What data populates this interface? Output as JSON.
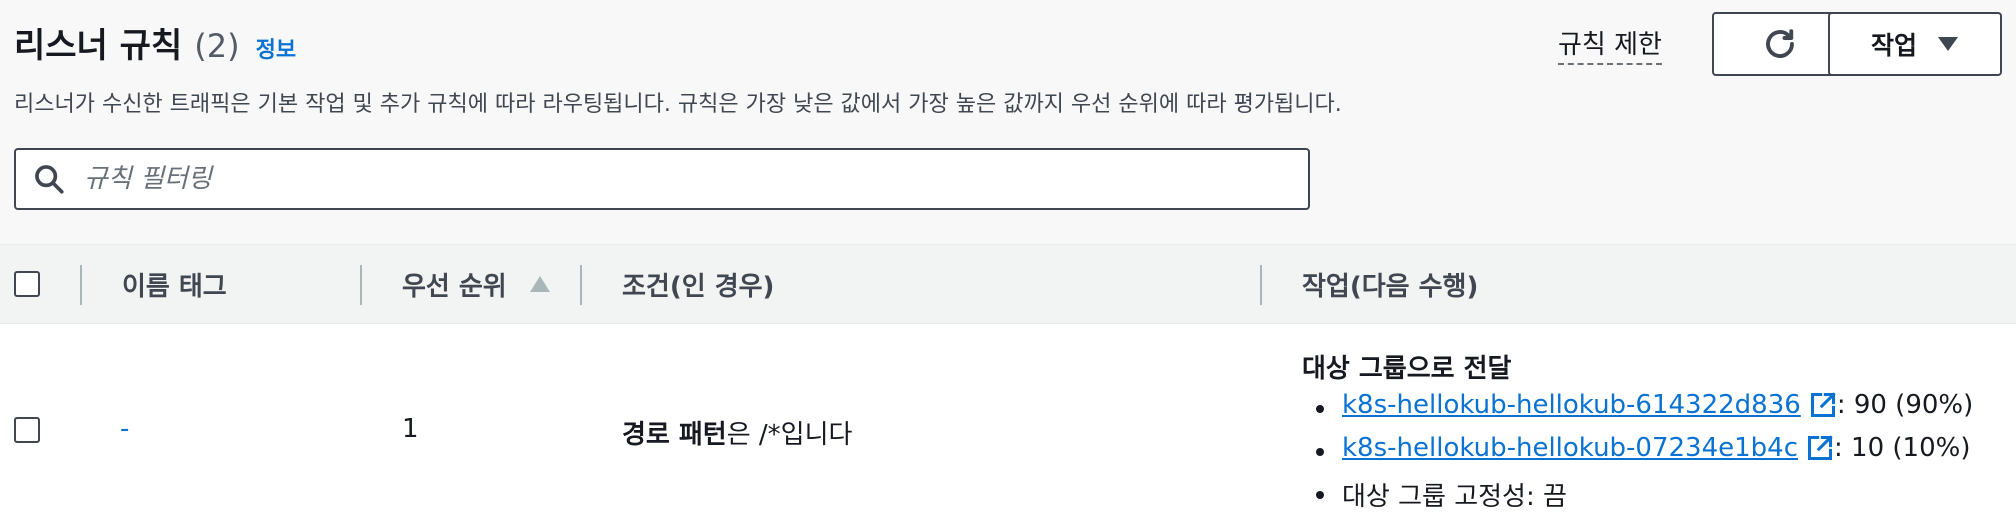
{
  "header": {
    "title": "리스너 규칙",
    "count": "(2)",
    "info_link": "정보",
    "description": "리스너가 수신한 트래픽은 기본 작업 및 추가 규칙에 따라 라우팅됩니다. 규칙은 가장 낮은 값에서 가장 높은 값까지 우선 순위에 따라 평가됩니다.",
    "rule_limit_label": "규칙 제한",
    "actions_button_label": "작업"
  },
  "search": {
    "placeholder": "규칙 필터링",
    "value": ""
  },
  "table": {
    "columns": [
      "이름 태그",
      "우선 순위",
      "조건(인 경우)",
      "작업(다음 수행)"
    ],
    "sort_column": "우선 순위",
    "sort_direction": "ascending",
    "rows": [
      {
        "name_tag": "-",
        "priority": "1",
        "condition_bold": "경로 패턴",
        "condition_rest": "은 /*입니다",
        "action_title": "대상 그룹으로 전달",
        "targets": [
          {
            "name": "k8s-hellokub-hellokub-614322d836",
            "weight": ": 90 (90%)"
          },
          {
            "name": "k8s-hellokub-hellokub-07234e1b4c",
            "weight": ": 10 (10%)"
          }
        ],
        "stickiness": "대상 그룹 고정성: 끔"
      }
    ]
  },
  "colors": {
    "link": "#0972d3",
    "text": "#16191f",
    "header_bg": "#f2f3f3"
  }
}
